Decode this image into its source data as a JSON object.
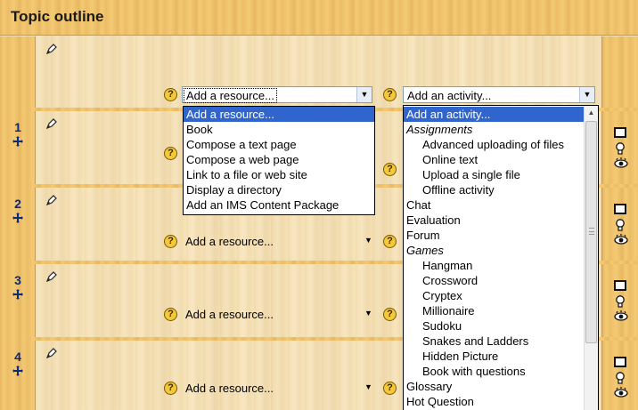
{
  "header": {
    "title": "Topic outline"
  },
  "sections": [
    {
      "number": "",
      "resource_select": "Add a resource...",
      "activity_select": "Add an activity..."
    },
    {
      "number": "1",
      "resource_select": "Add a resource..."
    },
    {
      "number": "2",
      "resource_select": "Add a resource..."
    },
    {
      "number": "3",
      "resource_select": "Add a resource..."
    },
    {
      "number": "4",
      "resource_select": "Add a resource..."
    }
  ],
  "resource_dropdown": {
    "options": [
      "Add a resource...",
      "Book",
      "Compose a text page",
      "Compose a web page",
      "Link to a file or web site",
      "Display a directory",
      "Add an IMS Content Package"
    ],
    "selected_index": 0
  },
  "activity_dropdown": {
    "selected_index": 0,
    "options": [
      {
        "label": "Add an activity...",
        "kind": "option"
      },
      {
        "label": "Assignments",
        "kind": "group"
      },
      {
        "label": "Advanced uploading of files",
        "kind": "indent"
      },
      {
        "label": "Online text",
        "kind": "indent"
      },
      {
        "label": "Upload a single file",
        "kind": "indent"
      },
      {
        "label": "Offline activity",
        "kind": "indent"
      },
      {
        "label": "Chat",
        "kind": "option"
      },
      {
        "label": "Evaluation",
        "kind": "option"
      },
      {
        "label": "Forum",
        "kind": "option"
      },
      {
        "label": "Games",
        "kind": "group"
      },
      {
        "label": "Hangman",
        "kind": "indent"
      },
      {
        "label": "Crossword",
        "kind": "indent"
      },
      {
        "label": "Cryptex",
        "kind": "indent"
      },
      {
        "label": "Millionaire",
        "kind": "indent"
      },
      {
        "label": "Sudoku",
        "kind": "indent"
      },
      {
        "label": "Snakes and Ladders",
        "kind": "indent"
      },
      {
        "label": "Hidden Picture",
        "kind": "indent"
      },
      {
        "label": "Book with questions",
        "kind": "indent"
      },
      {
        "label": "Glossary",
        "kind": "option"
      },
      {
        "label": "Hot Question",
        "kind": "option"
      }
    ]
  },
  "icons": {
    "edit": "pencil-icon",
    "move": "move-arrows-icon",
    "help": "help-icon",
    "show": "highlight-box-icon",
    "light": "lightbulb-icon",
    "visible": "eye-icon"
  },
  "colors": {
    "selection": "#3165ce",
    "section_number": "#0a2a7a",
    "help_icon": "#f3c83b"
  }
}
